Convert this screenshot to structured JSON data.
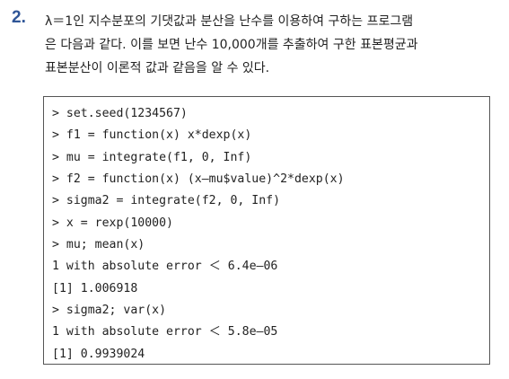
{
  "problem": {
    "number": "2.",
    "lines": [
      "λ＝1인 지수분포의 기댓값과 분산을 난수를 이용하여 구하는 프로그램",
      "은 다음과 같다. 이를 보면 난수 10,000개를 추출하여 구한 표본평균과",
      "표본분산이 이론적 값과 같음을 알 수 있다."
    ]
  },
  "code": {
    "lines": [
      "> set.seed(1234567)",
      "> f1 = function(x) x*dexp(x)",
      "> mu = integrate(f1, 0, Inf)",
      "> f2 = function(x) (x–mu$value)^2*dexp(x)",
      "> sigma2 = integrate(f2, 0, Inf)",
      "> x = rexp(10000)",
      "> mu; mean(x)",
      "1 with absolute error ＜ 6.4e–06",
      "[1] 1.006918",
      "> sigma2; var(x)",
      "1 with absolute error ＜ 5.8e–05",
      "[1] 0.9939024"
    ]
  }
}
